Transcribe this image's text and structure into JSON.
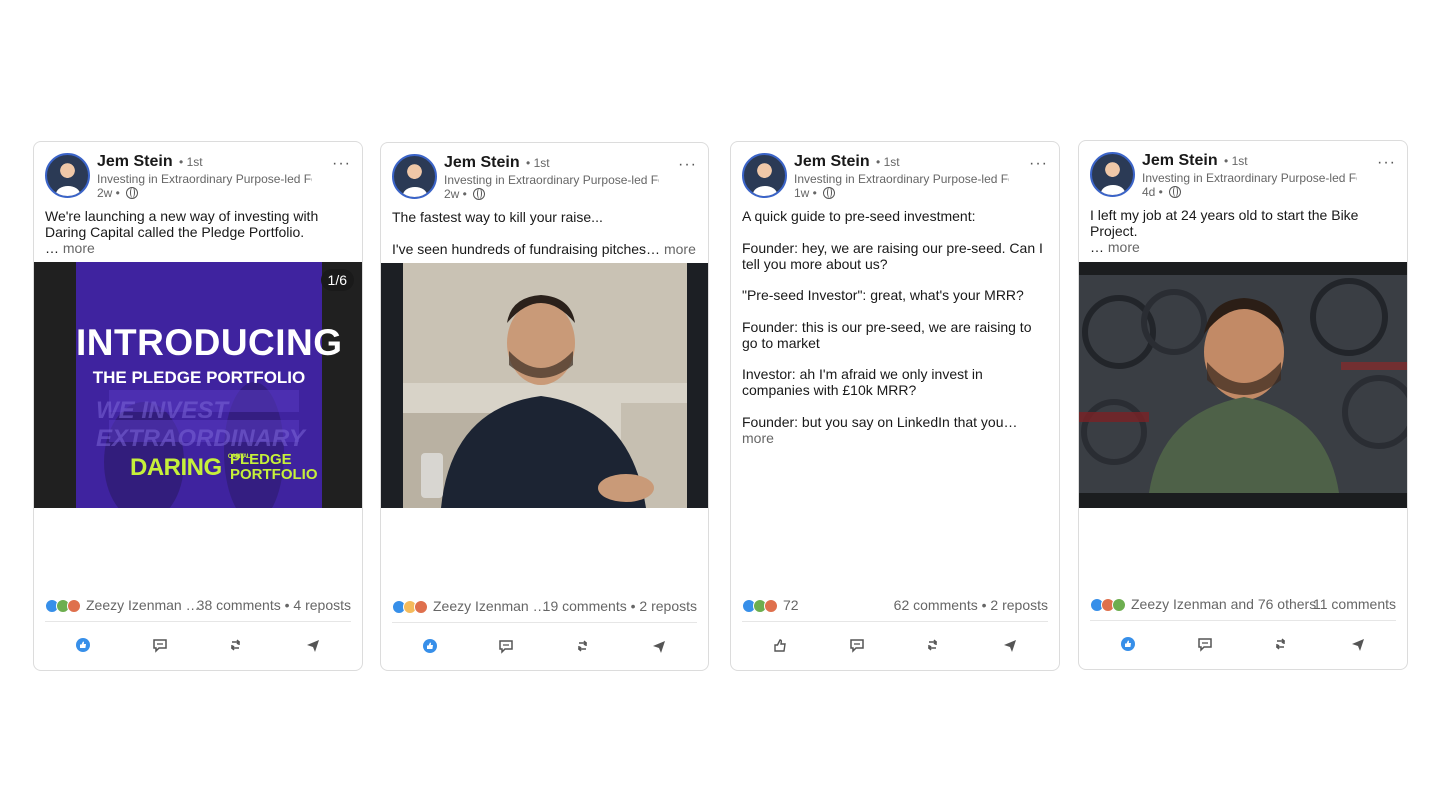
{
  "posts": [
    {
      "author": "Jem Stein",
      "degree": "• 1st",
      "headline": "Investing in Extraordinary Purpose-led Founders",
      "age": "2w •",
      "text": "We're launching a new way of investing with Daring Capital called the Pledge Portfolio.",
      "ellipsis": "…",
      "more": "more",
      "counter": "1/6",
      "media": {
        "title": "INTRODUCING",
        "subtitle": "THE PLEDGE PORTFOLIO",
        "watermark": "WE INVEST EXTRAORDINARY",
        "logo_left": "DARING",
        "logo_small": "CAPITAL",
        "logo_right_1": "PLEDGE",
        "logo_right_2": "PORTFOLIO"
      },
      "reactions_text": "Zeezy Izenman …",
      "comments": "38 comments",
      "reposts": "4 reposts"
    },
    {
      "author": "Jem Stein",
      "degree": "• 1st",
      "headline": "Investing in Extraordinary Purpose-led Founders",
      "age": "2w •",
      "line1": "The fastest way to kill your raise...",
      "line2": "I've seen hundreds of fundraising pitches…",
      "more": "more",
      "reactions_text": "Zeezy Izenman …",
      "comments": "19 comments",
      "reposts": "2 reposts"
    },
    {
      "author": "Jem Stein",
      "degree": "• 1st",
      "headline": "Investing in Extraordinary Purpose-led Founders",
      "age": "1w •",
      "paragraphs": [
        "A quick guide to pre-seed investment:",
        "Founder: hey, we are raising our pre-seed. Can I tell you more about us?",
        "\"Pre-seed Investor\": great, what's your MRR?",
        "Founder: this is our pre-seed, we are raising to go to market",
        "Investor: ah I'm afraid we only invest in companies with £10k MRR?"
      ],
      "last_line": "Founder: but you say on LinkedIn that you…",
      "more": "more",
      "reactions_text": "72",
      "comments": "62 comments",
      "reposts": "2 reposts"
    },
    {
      "author": "Jem Stein",
      "degree": "• 1st",
      "headline": "Investing in Extraordinary Purpose-led Founders",
      "age": "4d •",
      "text": "I left my job at 24 years old to start the Bike Project.",
      "ellipsis": "…",
      "more": "more",
      "reactions_text": "Zeezy Izenman and 76 others",
      "comments": "11 comments"
    }
  ],
  "colors": {
    "like": "#378fe9",
    "celebrate": "#6dae4f",
    "love": "#df704d",
    "support": "#c37d16",
    "insightful": "#f5bb5c",
    "brand_purple": "#4a2bb0",
    "brand_green": "#c6f03a"
  },
  "icons": [
    "like-icon",
    "comment-icon",
    "repost-icon",
    "send-icon",
    "globe-icon",
    "more-options-icon"
  ]
}
